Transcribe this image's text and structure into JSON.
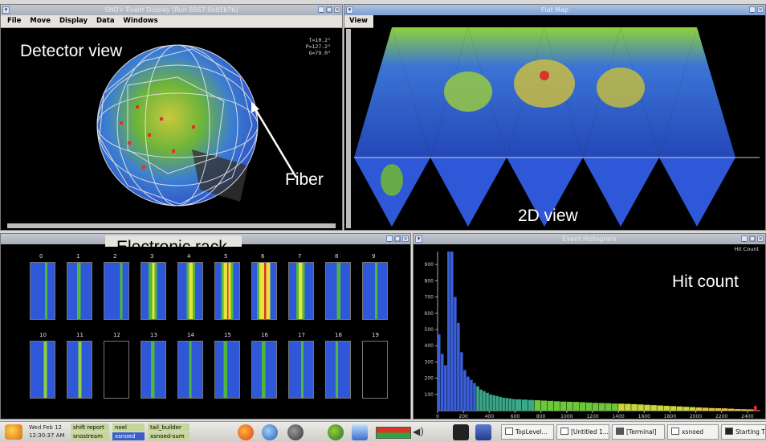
{
  "windows": {
    "detector": {
      "title": "SNO+ Event Display (Run 6567:0x01b7b)",
      "menu": [
        "File",
        "Move",
        "Display",
        "Data",
        "Windows"
      ]
    },
    "flatmap": {
      "title": "Flat Map",
      "menu": [
        "View"
      ]
    },
    "rack": {
      "title": ""
    },
    "histogram": {
      "title": "Event Histogram",
      "corner_label": "Hit Count"
    }
  },
  "readout": {
    "t": "T=10.2°",
    "p": "P=127.2°",
    "g": "G=79.0°"
  },
  "annotations": {
    "detector_view": "Detector view",
    "fiber": "Fiber",
    "view_2d": "2D view",
    "electronic_rack": "Electronic rack",
    "hit_count": "Hit count"
  },
  "rack": {
    "top_numbers": [
      "0",
      "1",
      "2",
      "3",
      "4",
      "5",
      "6",
      "7",
      "8",
      "9"
    ],
    "bottom_numbers": [
      "10",
      "11",
      "12",
      "13",
      "14",
      "15",
      "16",
      "17",
      "18",
      "19"
    ]
  },
  "chart_data": {
    "type": "bar",
    "title": "Hit Count",
    "xlabel": "",
    "ylabel": "",
    "xlim": [
      0,
      2500
    ],
    "ylim": [
      0,
      980
    ],
    "x_ticks": [
      0,
      200,
      400,
      600,
      800,
      1000,
      1200,
      1400,
      1600,
      1800,
      2000,
      2200,
      2400
    ],
    "y_ticks": [
      100,
      200,
      300,
      400,
      500,
      600,
      700,
      800,
      900
    ],
    "bin_width": 25,
    "x": [
      0,
      25,
      50,
      75,
      100,
      125,
      150,
      175,
      200,
      225,
      250,
      275,
      300,
      325,
      350,
      375,
      400,
      425,
      450,
      475,
      500,
      525,
      550,
      575,
      600,
      650,
      700,
      750,
      800,
      850,
      900,
      950,
      1000,
      1050,
      1100,
      1150,
      1200,
      1250,
      1300,
      1350,
      1400,
      1450,
      1500,
      1550,
      1600,
      1650,
      1700,
      1750,
      1800,
      1850,
      1900,
      1950,
      2000,
      2050,
      2100,
      2150,
      2200,
      2250,
      2300,
      2350,
      2400,
      2450
    ],
    "values": [
      470,
      350,
      280,
      980,
      980,
      700,
      540,
      360,
      250,
      210,
      190,
      170,
      150,
      130,
      120,
      110,
      100,
      95,
      90,
      85,
      80,
      78,
      75,
      72,
      70,
      68,
      66,
      64,
      62,
      60,
      58,
      56,
      55,
      54,
      52,
      50,
      48,
      47,
      46,
      44,
      43,
      42,
      40,
      38,
      36,
      34,
      32,
      30,
      28,
      26,
      24,
      22,
      20,
      18,
      16,
      15,
      14,
      12,
      10,
      9,
      8,
      30
    ]
  },
  "taskbar": {
    "date": "Wed Feb 12",
    "time": "12:30:37 AM",
    "chips_top": [
      "shift report",
      "noel",
      "tail_builder"
    ],
    "chips_bottom": [
      "snostream",
      "xsnoed",
      "xsnoed-sum"
    ],
    "tasks": [
      "TopLevel...",
      "[Untitled 1...",
      "[Terminal]",
      "xsnoed",
      "Starting T..."
    ]
  },
  "colors": {
    "accent": "#7e9fd0",
    "pmt_blue": "#2f58d8",
    "pmt_green": "#4db83a",
    "pmt_yellow": "#e8e23a",
    "pmt_red": "#d8342a"
  }
}
